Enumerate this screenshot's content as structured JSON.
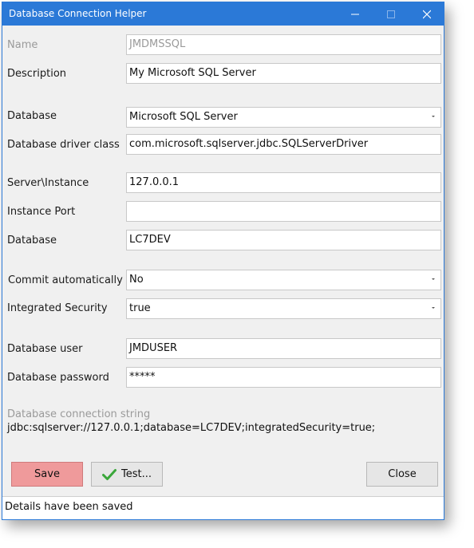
{
  "window": {
    "title": "Database Connection Helper"
  },
  "form": {
    "name": {
      "label": "Name",
      "value": "JMDMSSQL"
    },
    "description": {
      "label": "Description",
      "value": "My Microsoft SQL Server"
    },
    "database_type": {
      "label": "Database",
      "value": "Microsoft SQL Server"
    },
    "driver_class": {
      "label": "Database driver class",
      "value": "com.microsoft.sqlserver.jdbc.SQLServerDriver"
    },
    "server_instance": {
      "label": "Server\\Instance",
      "value": "127.0.0.1"
    },
    "instance_port": {
      "label": "Instance Port",
      "value": ""
    },
    "database_name": {
      "label": "Database",
      "value": "LC7DEV"
    },
    "commit_auto": {
      "label": "Commit automatically",
      "value": "No"
    },
    "integrated_security": {
      "label": "Integrated Security",
      "value": "true"
    },
    "db_user": {
      "label": "Database user",
      "value": "JMDUSER"
    },
    "db_password": {
      "label": "Database password",
      "value": "*****"
    }
  },
  "connection_string": {
    "caption": "Database connection string",
    "value": "jdbc:sqlserver://127.0.0.1;database=LC7DEV;integratedSecurity=true;"
  },
  "buttons": {
    "save": "Save",
    "test": "Test...",
    "close": "Close"
  },
  "status": "Details have been saved",
  "colors": {
    "titlebar": "#2b79d7",
    "save_button": "#ef9a9b",
    "check_icon": "#3aa73a"
  }
}
